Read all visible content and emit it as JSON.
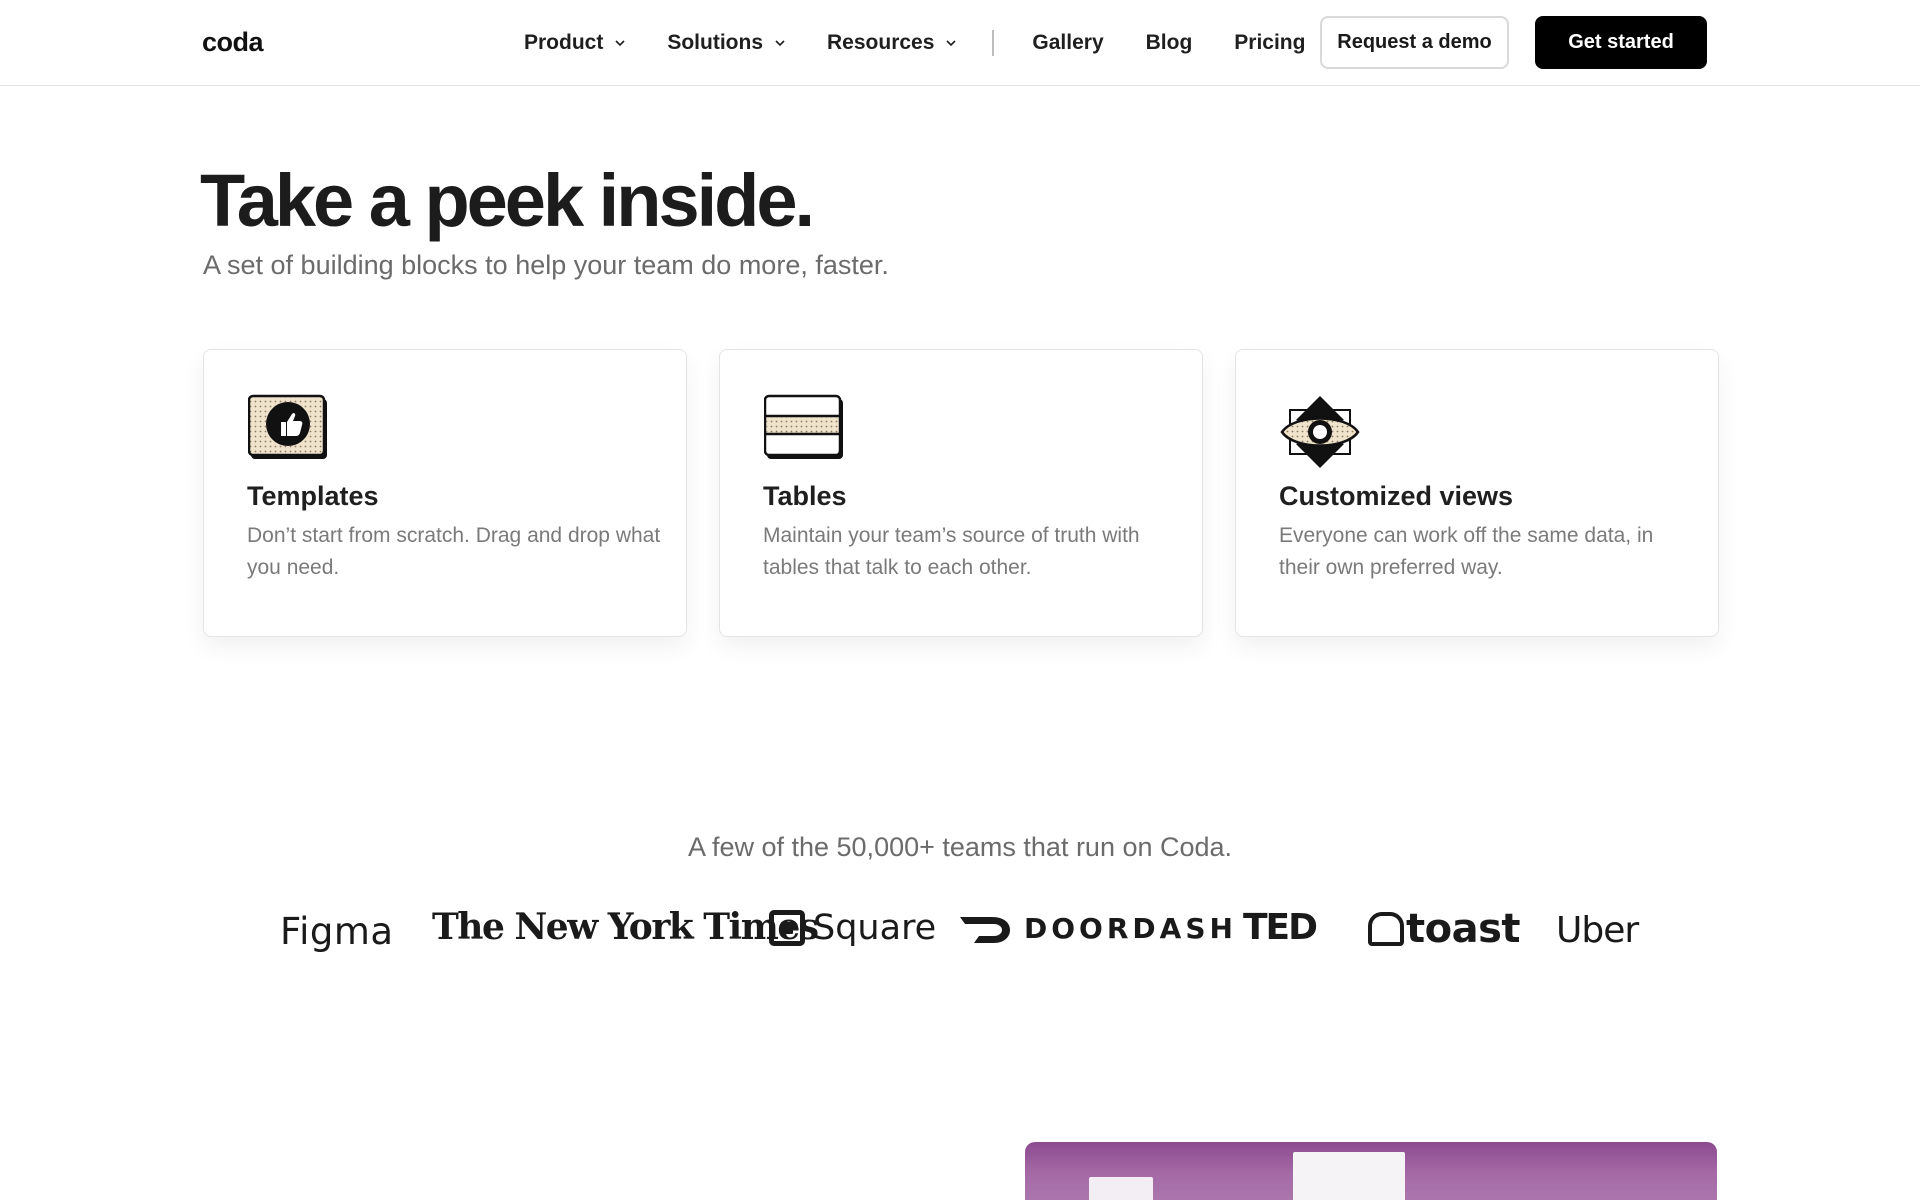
{
  "header": {
    "logo": "coda",
    "nav": [
      {
        "label": "Product",
        "dropdown": true
      },
      {
        "label": "Solutions",
        "dropdown": true
      },
      {
        "label": "Resources",
        "dropdown": true
      }
    ],
    "links": [
      "Gallery",
      "Blog",
      "Pricing"
    ],
    "request_demo_label": "Request a demo",
    "get_started_label": "Get started"
  },
  "hero": {
    "title": "Take a peek inside.",
    "subtitle": "A set of building blocks to help your team do more, faster."
  },
  "cards": [
    {
      "icon": "thumbs-up-icon",
      "title": "Templates",
      "desc": "Don’t start from scratch. Drag and drop what you need."
    },
    {
      "icon": "table-icon",
      "title": "Tables",
      "desc": "Maintain your team’s source of truth with tables that talk to each other."
    },
    {
      "icon": "eye-icon",
      "title": "Customized views",
      "desc": "Everyone can work off the same data, in their own preferred way."
    }
  ],
  "teams": {
    "text": "A few of the 50,000+ teams that run on Coda.",
    "logos": [
      "Figma",
      "The New York Times",
      "Square",
      "DOORDASH",
      "TED",
      "toast",
      "Uber"
    ]
  },
  "colors": {
    "accent_beige": "#efe3cc",
    "primary_button": "#000000",
    "preview_purple": "#9c5fa0"
  }
}
